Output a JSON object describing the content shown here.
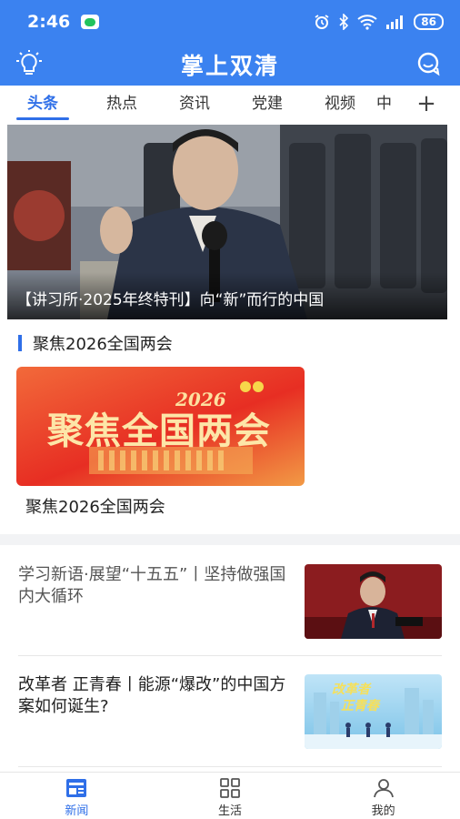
{
  "status": {
    "time": "2:46",
    "battery": "86",
    "signal_icons": [
      "alarm-icon",
      "bluetooth-icon",
      "wifi-icon",
      "signal-icon"
    ]
  },
  "header": {
    "title": "掌上双清",
    "left_icon": "lightbulb-icon",
    "right_icon": "chat-icon"
  },
  "tabs": [
    {
      "label": "头条",
      "active": true
    },
    {
      "label": "热点"
    },
    {
      "label": "资讯"
    },
    {
      "label": "党建"
    },
    {
      "label": "视频"
    },
    {
      "label": "中心"
    }
  ],
  "hero": {
    "caption": "【讲习所·2025年终特刊】向“新”而行的中国"
  },
  "section": {
    "title": "聚焦2026全国两会",
    "card_label": "聚焦2026全国两会",
    "banner": {
      "year": "2026",
      "headline": "聚焦全国两会"
    }
  },
  "news": [
    {
      "title": "学习新语·展望“十五五”丨坚持做强国内大循环",
      "muted": true
    },
    {
      "title": "改革者 正青春丨能源“爆改”的中国方案如何诞生?"
    }
  ],
  "news_thumb_text": {
    "title_line1": "改革者",
    "title_line2": "正青春"
  },
  "bottom_nav": [
    {
      "label": "新闻",
      "icon": "news-icon",
      "active": true
    },
    {
      "label": "生活",
      "icon": "grid-icon"
    },
    {
      "label": "我的",
      "icon": "user-icon"
    }
  ],
  "colors": {
    "brand": "#3b82f0",
    "accent": "#2f6fe8"
  }
}
